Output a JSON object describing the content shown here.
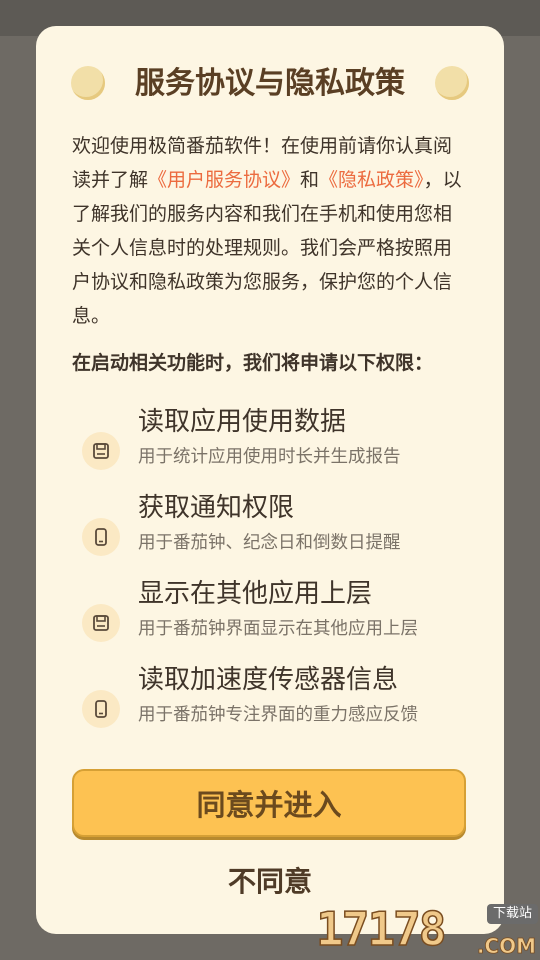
{
  "dialog": {
    "title": "服务协议与隐私政策",
    "intro": {
      "part1": "欢迎使用极简番茄软件！在使用前请你认真阅读并了解",
      "link_service": "《用户服务协议》",
      "and": "和",
      "link_privacy": "《隐私政策》",
      "part2": "，以了解我们的服务内容和我们在手机和使用您相关个人信息时的处理规则。我们会严格按照用户协议和隐私政策为您服务，保护您的个人信息。"
    },
    "permissions_heading": "在启动相关功能时，我们将申请以下权限：",
    "permissions": [
      {
        "icon": "save-icon",
        "title": "读取应用使用数据",
        "desc": "用于统计应用使用时长并生成报告"
      },
      {
        "icon": "phone-icon",
        "title": "获取通知权限",
        "desc": "用于番茄钟、纪念日和倒数日提醒"
      },
      {
        "icon": "save-icon",
        "title": "显示在其他应用上层",
        "desc": "用于番茄钟界面显示在其他应用上层"
      },
      {
        "icon": "phone-icon",
        "title": "读取加速度传感器信息",
        "desc": "用于番茄钟专注界面的重力感应反馈"
      }
    ],
    "agree_label": "同意并进入",
    "decline_label": "不同意"
  },
  "watermark": {
    "number": "17178",
    "badge": "下载站",
    "suffix": ".COM"
  },
  "colors": {
    "dialog_bg": "#fdf6e3",
    "accent_link": "#ec6b3f",
    "button_bg": "#fdc252",
    "overlay": "#6e6a64"
  }
}
